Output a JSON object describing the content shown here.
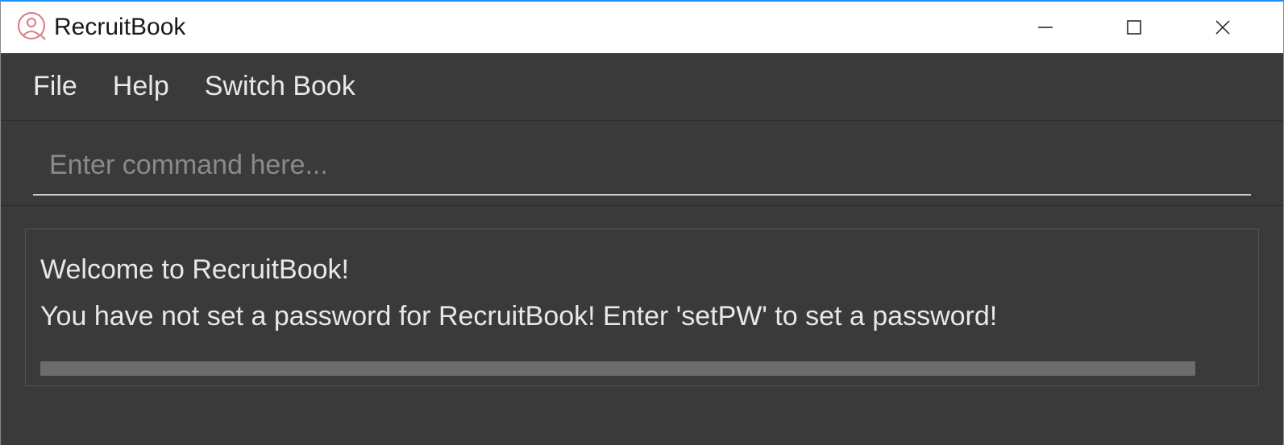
{
  "window": {
    "title": "RecruitBook"
  },
  "menubar": {
    "items": [
      {
        "label": "File"
      },
      {
        "label": "Help"
      },
      {
        "label": "Switch Book"
      }
    ]
  },
  "command": {
    "placeholder": "Enter command here...",
    "value": ""
  },
  "output": {
    "text": "Welcome to RecruitBook!\nYou have not set a password for RecruitBook! Enter 'setPW' to set a password!"
  },
  "colors": {
    "accent": "#1e90ff",
    "icon": "#d77a85",
    "bg_dark": "#3a3a3a",
    "text_light": "#e8e8e8"
  }
}
